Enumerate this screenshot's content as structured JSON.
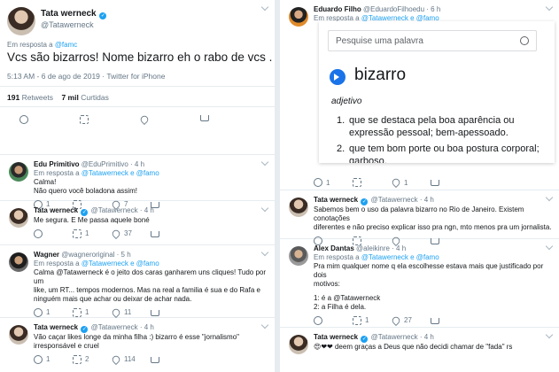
{
  "left": {
    "main_tweet": {
      "name": "Tata werneck",
      "handle": "@Tatawerneck",
      "reply_prefix": "Em resposta a",
      "reply_to": "@famc",
      "text": "Vcs são bizarros! Nome bizarro eh o rabo de vcs .",
      "meta": "5:13 AM - 6 de ago de 2019 · Twitter for iPhone",
      "retweets_count": "191",
      "retweets_label": "Retweets",
      "likes_count": "7 mil",
      "likes_label": "Curtidas"
    },
    "replies": [
      {
        "name": "Edu Primitivo",
        "handle": "@EduPrimitivo · 4 h",
        "reply_to": "@Tatawerneck e @famo",
        "lines": [
          "Calma!",
          "Não quero você boladona assim!"
        ],
        "counts": [
          "1",
          "",
          "7",
          ""
        ]
      },
      {
        "name": "Tata werneck",
        "handle": "@Tatawerneck · 4 h",
        "reply_to": "",
        "lines": [
          "Me segura. E Me passa aquele boné"
        ],
        "counts": [
          "",
          "1",
          "37",
          ""
        ]
      },
      {
        "name": "Wagner",
        "handle": "@wagneroriginal · 5 h",
        "reply_to": "@Tatawerneck e @famo",
        "lines": [
          "Calma @Tatawerneck é o jeito dos caras ganharem uns cliques! Tudo por um",
          "like, um RT... tempos modernos. Mas na real a familia é sua e do Rafa e",
          "ninguém mais que achar ou deixar de achar nada."
        ],
        "counts": [
          "1",
          "1",
          "11",
          ""
        ]
      },
      {
        "name": "Tata werneck",
        "handle": "@Tatawerneck · 4 h",
        "reply_to": "",
        "lines": [
          "Vão caçar likes longe da minha filha :) bizarro é esse \"jornalismo\"",
          "irresponsável e cruel"
        ],
        "counts": [
          "1",
          "2",
          "114",
          ""
        ]
      }
    ]
  },
  "right": {
    "top_tweet": {
      "name": "Eduardo Filho",
      "handle": "@EduardoFilhoedu · 6 h",
      "reply_to": "@Tatawerneck e @famo"
    },
    "dictionary": {
      "search_placeholder": "Pesquise uma palavra",
      "word": "bizarro",
      "pos": "adjetivo",
      "defs": [
        {
          "n": "1.",
          "text": "que se destaca pela boa aparência ou expressão pessoal; bem-apessoado."
        },
        {
          "n": "2.",
          "text": "que tem bom porte ou boa postura corporal; garboso."
        }
      ]
    },
    "top_counts": [
      "1",
      "",
      "1",
      ""
    ],
    "tweets": [
      {
        "name": "Tata werneck",
        "handle": "@Tatawerneck · 4 h",
        "reply_to": "",
        "lines": [
          "Sabemos bem o uso da palavra bizarro no Rio de Janeiro. Existem conotações",
          "diferentes e não preciso explicar isso pra ngn, mto menos pra um jornalista."
        ],
        "counts": [
          "",
          "",
          "",
          ""
        ]
      },
      {
        "name": "Alex Dantas",
        "handle": "@aleikinre · 4 h",
        "reply_to": "@Tatawerneck e @famo",
        "lines": [
          "Pra mim qualquer nome q ela escolhesse estava mais que justificado por dois",
          "motivos:",
          "",
          "1: é a @Tatawerneck",
          "2: a Filha é dela."
        ],
        "counts": [
          "",
          "1",
          "27",
          ""
        ]
      },
      {
        "name": "Tata werneck",
        "handle": "@Tatawerneck · 4 h",
        "reply_to": "",
        "lines": [
          "😍❤❤ deem graças a Deus que não decidi chamar de \"fada\" rs"
        ],
        "counts": []
      }
    ]
  }
}
